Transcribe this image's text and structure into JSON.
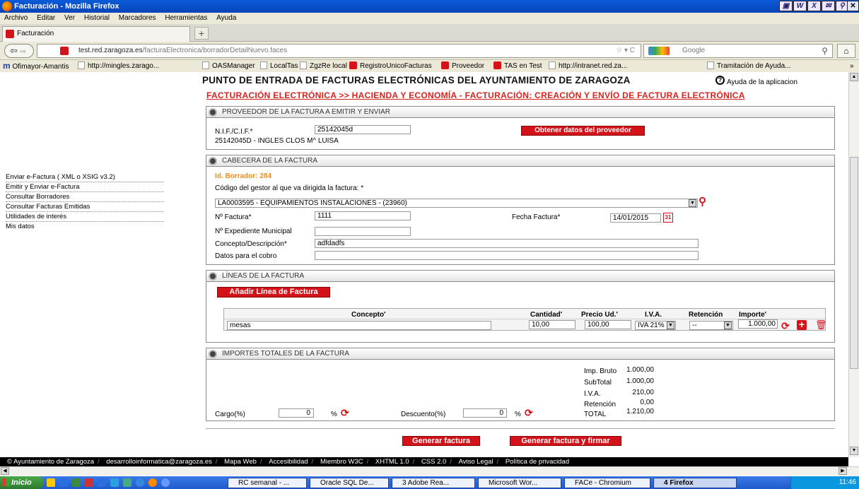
{
  "window": {
    "title": "Facturación - Mozilla Firefox"
  },
  "menu": [
    "Archivo",
    "Editar",
    "Ver",
    "Historial",
    "Marcadores",
    "Herramientas",
    "Ayuda"
  ],
  "tab": {
    "label": "Facturación",
    "new": "+"
  },
  "address": {
    "host": "test.red.zaragoza.es",
    "path": "/facturaElectronica/borradorDetailNuevo.faces"
  },
  "search": {
    "placeholder": "Google"
  },
  "bookmarks": [
    "Ofimayor-Amantis",
    "http://mingles.zarago...",
    "OASManager",
    "LocalTas",
    "ZgzRe local",
    "RegistroUnicoFacturas",
    "Proveedor",
    "TAS en Test",
    "http://intranet.red.za...",
    "Tramitación de Ayuda..."
  ],
  "page": {
    "title": "PUNTO DE ENTRADA DE FACTURAS ELECTRÓNICAS DEL AYUNTAMIENTO DE ZARAGOZA",
    "help": "Ayuda de la aplicacion",
    "breadcrumb": "FACTURACIÓN ELECTRÓNICA >> HACIENDA Y ECONOMÍA - FACTURACIÓN: CREACIÓN Y ENVÍO DE FACTURA ELECTRÓNICA"
  },
  "sidebar": [
    "Enviar e-Factura ( XML o XSIG v3.2)",
    "Emitir y Enviar e-Factura",
    "Consultar Borradores",
    "Consultar Facturas Emitidas",
    "Utilidades de interés",
    "Mis datos"
  ],
  "proveedor": {
    "header": "PROVEEDOR DE LA FACTURA A EMITIR Y ENVIAR",
    "nif_label": "N.I.F./C.I.F.",
    "nif_value": "25142045d",
    "button": "Obtener datos del proveedor",
    "name": "25142045D - INGLES CLOS M^ LUISA"
  },
  "cabecera": {
    "header": "CABECERA DE LA FACTURA",
    "borrador": "Id. Borrador: 284",
    "gestor_label": "Código del gestor al que va dirigida la factura:",
    "gestor_value": "LA0003595 - EQUIPAMIENTOS INSTALACIONES - (23960)",
    "nfactura_label": "Nº Factura",
    "nfactura_value": "1111",
    "fecha_label": "Fecha Factura",
    "fecha_value": "14/01/2015",
    "expediente_label": "Nº Expediente Municipal",
    "expediente_value": "",
    "concepto_label": "Concepto/Descripción",
    "concepto_value": "adfdadfs",
    "cobro_label": "Datos para el cobro",
    "cobro_value": ""
  },
  "lineas": {
    "header": "LÍNEAS DE LA FACTURA",
    "add_button": "Añadir Línea de Factura",
    "columns": [
      "Concepto",
      "Cantidad",
      "Precio Ud.",
      "I.V.A.",
      "Retención",
      "Importe"
    ],
    "row": {
      "concepto": "mesas",
      "cantidad": "10,00",
      "precio": "100,00",
      "iva": "IVA 21%",
      "retencion": "--",
      "importe": "1.000,00"
    }
  },
  "totales": {
    "header": "IMPORTES TOTALES DE LA FACTURA",
    "items": [
      {
        "label": "Imp. Bruto",
        "value": "1.000,00"
      },
      {
        "label": "SubTotal",
        "value": "1.000,00"
      },
      {
        "label": "I.V.A.",
        "value": "210,00"
      },
      {
        "label": "Retención",
        "value": "0,00"
      },
      {
        "label": "TOTAL",
        "value": "1.210,00"
      }
    ],
    "cargo_label": "Cargo(%)",
    "cargo_value": "0",
    "descuento_label": "Descuento(%)",
    "descuento_value": "0",
    "pct": "%"
  },
  "actions": {
    "generar": "Generar factura",
    "generar_firmar": "Generar factura y firmar"
  },
  "footer": [
    "© Ayuntamiento de Zaragoza",
    "desarrolloinformatica@zaragoza.es",
    "Mapa Web",
    "Accesibilidad",
    "Miembro W3C",
    "XHTML 1.0",
    "CSS 2.0",
    "Aviso Legal",
    "Política de privacidad"
  ],
  "taskbar": {
    "start": "Inicio",
    "items": [
      "RC semanal - ...",
      "Oracle SQL De...",
      "3 Adobe Rea...",
      "Microsoft Wor...",
      "FACe - Chromium",
      "4 Firefox"
    ],
    "time": "11:46"
  },
  "marks": {
    "required": "*",
    "chevron": "»",
    "req2": "'",
    "x": "X"
  },
  "colors": {
    "accent": "#d4121a",
    "titlebar": "#0644b8"
  }
}
